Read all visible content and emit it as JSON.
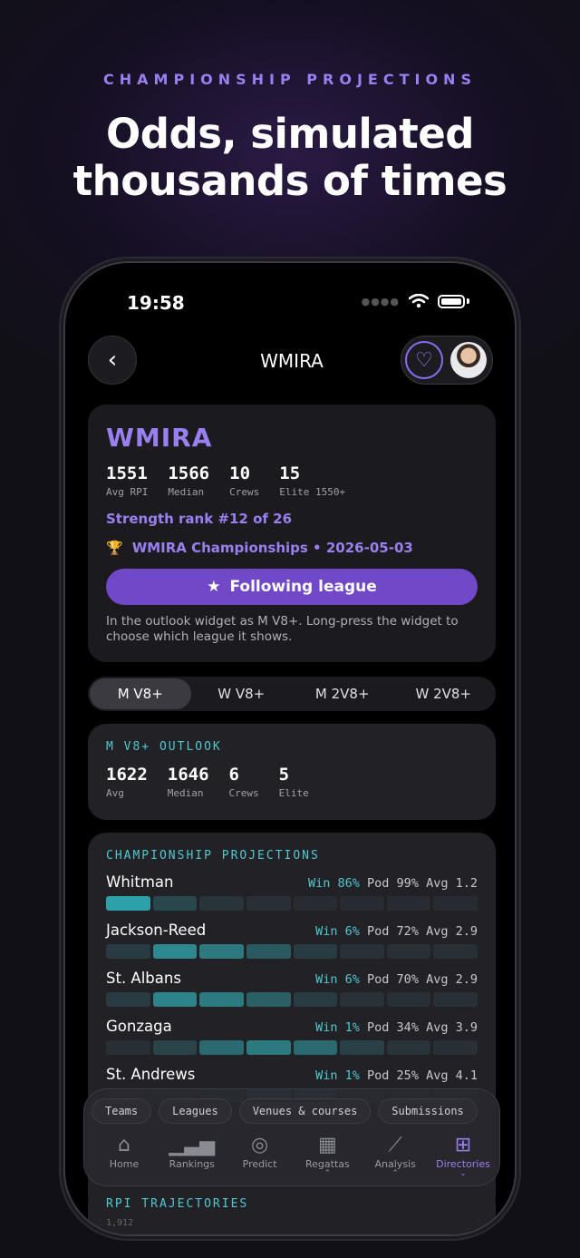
{
  "promo": {
    "kicker": "CHAMPIONSHIP PROJECTIONS",
    "headline_line1": "Odds, simulated",
    "headline_line2": "thousands of times"
  },
  "status": {
    "time": "19:58"
  },
  "nav": {
    "title": "WMIRA"
  },
  "league": {
    "name": "WMIRA",
    "stats": [
      {
        "value": "1551",
        "label": "Avg RPI"
      },
      {
        "value": "1566",
        "label": "Median"
      },
      {
        "value": "10",
        "label": "Crews"
      },
      {
        "value": "15",
        "label": "Elite 1550+"
      }
    ],
    "strength": "Strength rank #12 of 26",
    "championship": "WMIRA Championships • 2026-05-03",
    "follow_label": "Following league",
    "follow_note": "In the outlook widget as M V8+. Long-press the widget to choose which league it shows."
  },
  "segments": [
    "M V8+",
    "W V8+",
    "M 2V8+",
    "W 2V8+"
  ],
  "outlook": {
    "label": "M V8+ OUTLOOK",
    "stats": [
      {
        "value": "1622",
        "label": "Avg"
      },
      {
        "value": "1646",
        "label": "Median"
      },
      {
        "value": "6",
        "label": "Crews"
      },
      {
        "value": "5",
        "label": "Elite"
      }
    ]
  },
  "projections": {
    "label": "CHAMPIONSHIP PROJECTIONS",
    "teams": [
      {
        "name": "Whitman",
        "win": "Win 86%",
        "pod": "Pod 99%",
        "avg": "Avg 1.2",
        "place_probs": [
          0.86,
          0.1,
          0.03,
          0.01,
          0,
          0,
          0,
          0
        ]
      },
      {
        "name": "Jackson-Reed",
        "win": "Win 6%",
        "pod": "Pod 72%",
        "avg": "Avg 2.9",
        "place_probs": [
          0.06,
          0.36,
          0.3,
          0.18,
          0.06,
          0.02,
          0.01,
          0.01
        ]
      },
      {
        "name": "St. Albans",
        "win": "Win 6%",
        "pod": "Pod 70%",
        "avg": "Avg 2.9",
        "place_probs": [
          0.06,
          0.34,
          0.3,
          0.2,
          0.06,
          0.02,
          0.01,
          0.01
        ]
      },
      {
        "name": "Gonzaga",
        "win": "Win 1%",
        "pod": "Pod 34%",
        "avg": "Avg 3.9",
        "place_probs": [
          0.01,
          0.09,
          0.24,
          0.3,
          0.24,
          0.08,
          0.03,
          0.01
        ]
      },
      {
        "name": "St. Andrews",
        "win": "Win 1%",
        "pod": "Pod 25%",
        "avg": "Avg 4.1",
        "place_probs": [
          0.01,
          0.06,
          0.18,
          0.3,
          0.28,
          0.1,
          0.05,
          0.02
        ]
      }
    ]
  },
  "dock": {
    "chips": [
      "Teams",
      "Leagues",
      "Venues & courses",
      "Submissions"
    ],
    "tabs": [
      {
        "label": "Home",
        "icon": "home-icon",
        "glyph": "⌂"
      },
      {
        "label": "Rankings",
        "icon": "bar-chart-icon",
        "glyph": "▁▃▅"
      },
      {
        "label": "Predict",
        "icon": "target-icon",
        "glyph": "◎"
      },
      {
        "label": "Regattas",
        "icon": "calendar-icon",
        "glyph": "▦"
      },
      {
        "label": "Analysis",
        "icon": "trend-icon",
        "glyph": "⟋"
      },
      {
        "label": "Directories",
        "icon": "grid-icon",
        "glyph": "⊞"
      }
    ]
  },
  "trajectories": {
    "label": "RPI TRAJECTORIES",
    "first_tick": "1,912"
  },
  "colors": {
    "accent": "#9a7ff0",
    "teal": "#4fc8d0",
    "follow": "#7048c8"
  }
}
